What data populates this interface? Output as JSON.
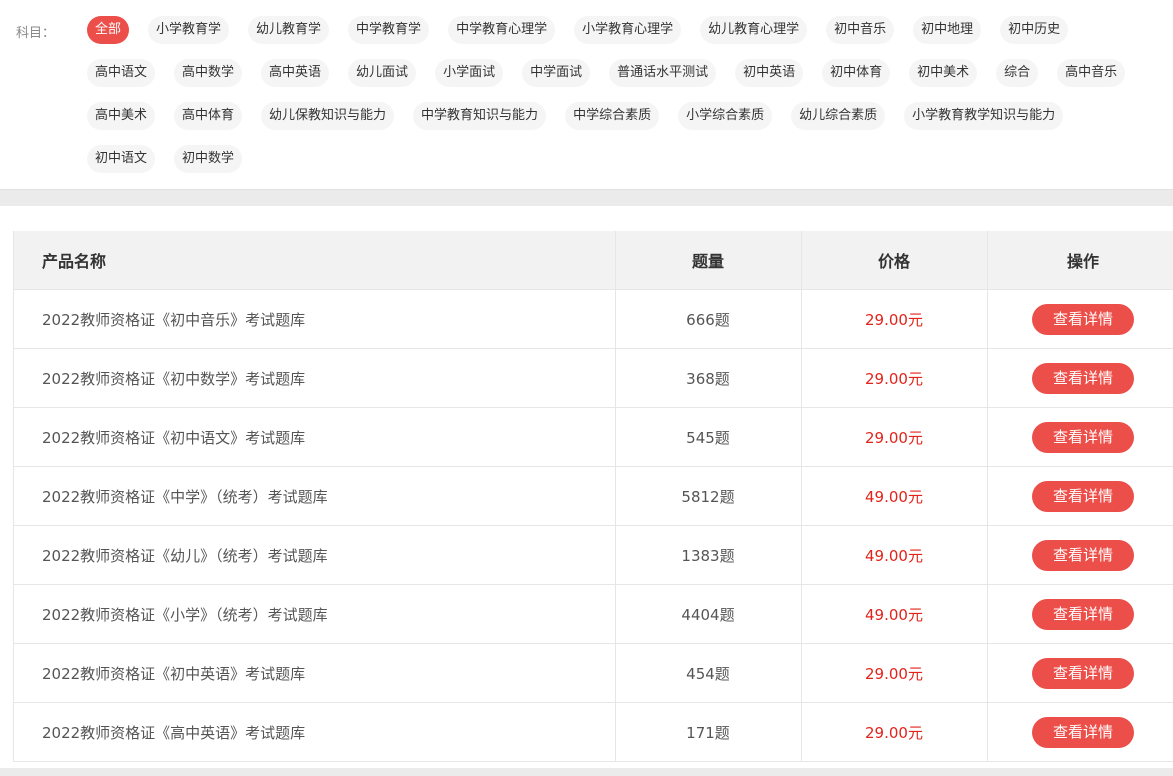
{
  "filter": {
    "label": "科目：",
    "tags": [
      {
        "label": "全部",
        "active": true
      },
      {
        "label": "小学教育学"
      },
      {
        "label": "幼儿教育学"
      },
      {
        "label": "中学教育学"
      },
      {
        "label": "中学教育心理学"
      },
      {
        "label": "小学教育心理学"
      },
      {
        "label": "幼儿教育心理学"
      },
      {
        "label": "初中音乐"
      },
      {
        "label": "初中地理"
      },
      {
        "label": "初中历史"
      },
      {
        "label": "高中语文"
      },
      {
        "label": "高中数学"
      },
      {
        "label": "高中英语"
      },
      {
        "label": "幼儿面试"
      },
      {
        "label": "小学面试"
      },
      {
        "label": "中学面试"
      },
      {
        "label": "普通话水平测试"
      },
      {
        "label": "初中英语"
      },
      {
        "label": "初中体育"
      },
      {
        "label": "初中美术"
      },
      {
        "label": "综合"
      },
      {
        "label": "高中音乐"
      },
      {
        "label": "高中美术"
      },
      {
        "label": "高中体育"
      },
      {
        "label": "幼儿保教知识与能力"
      },
      {
        "label": "中学教育知识与能力"
      },
      {
        "label": "中学综合素质"
      },
      {
        "label": "小学综合素质"
      },
      {
        "label": "幼儿综合素质"
      },
      {
        "label": "小学教育教学知识与能力"
      },
      {
        "label": "初中语文"
      },
      {
        "label": "初中数学"
      }
    ]
  },
  "table": {
    "headers": {
      "name": "产品名称",
      "count": "题量",
      "price": "价格",
      "action": "操作"
    },
    "button_label": "查看详情",
    "rows": [
      {
        "name": "2022教师资格证《初中音乐》考试题库",
        "count": "666题",
        "price": "29.00元"
      },
      {
        "name": "2022教师资格证《初中数学》考试题库",
        "count": "368题",
        "price": "29.00元"
      },
      {
        "name": "2022教师资格证《初中语文》考试题库",
        "count": "545题",
        "price": "29.00元"
      },
      {
        "name": "2022教师资格证《中学》（统考）考试题库",
        "count": "5812题",
        "price": "49.00元"
      },
      {
        "name": "2022教师资格证《幼儿》（统考）考试题库",
        "count": "1383题",
        "price": "49.00元"
      },
      {
        "name": "2022教师资格证《小学》（统考）考试题库",
        "count": "4404题",
        "price": "49.00元"
      },
      {
        "name": "2022教师资格证《初中英语》考试题库",
        "count": "454题",
        "price": "29.00元"
      },
      {
        "name": "2022教师资格证《高中英语》考试题库",
        "count": "171题",
        "price": "29.00元"
      }
    ]
  },
  "colors": {
    "accent": "#ec4f4a",
    "price": "#e2231a"
  }
}
